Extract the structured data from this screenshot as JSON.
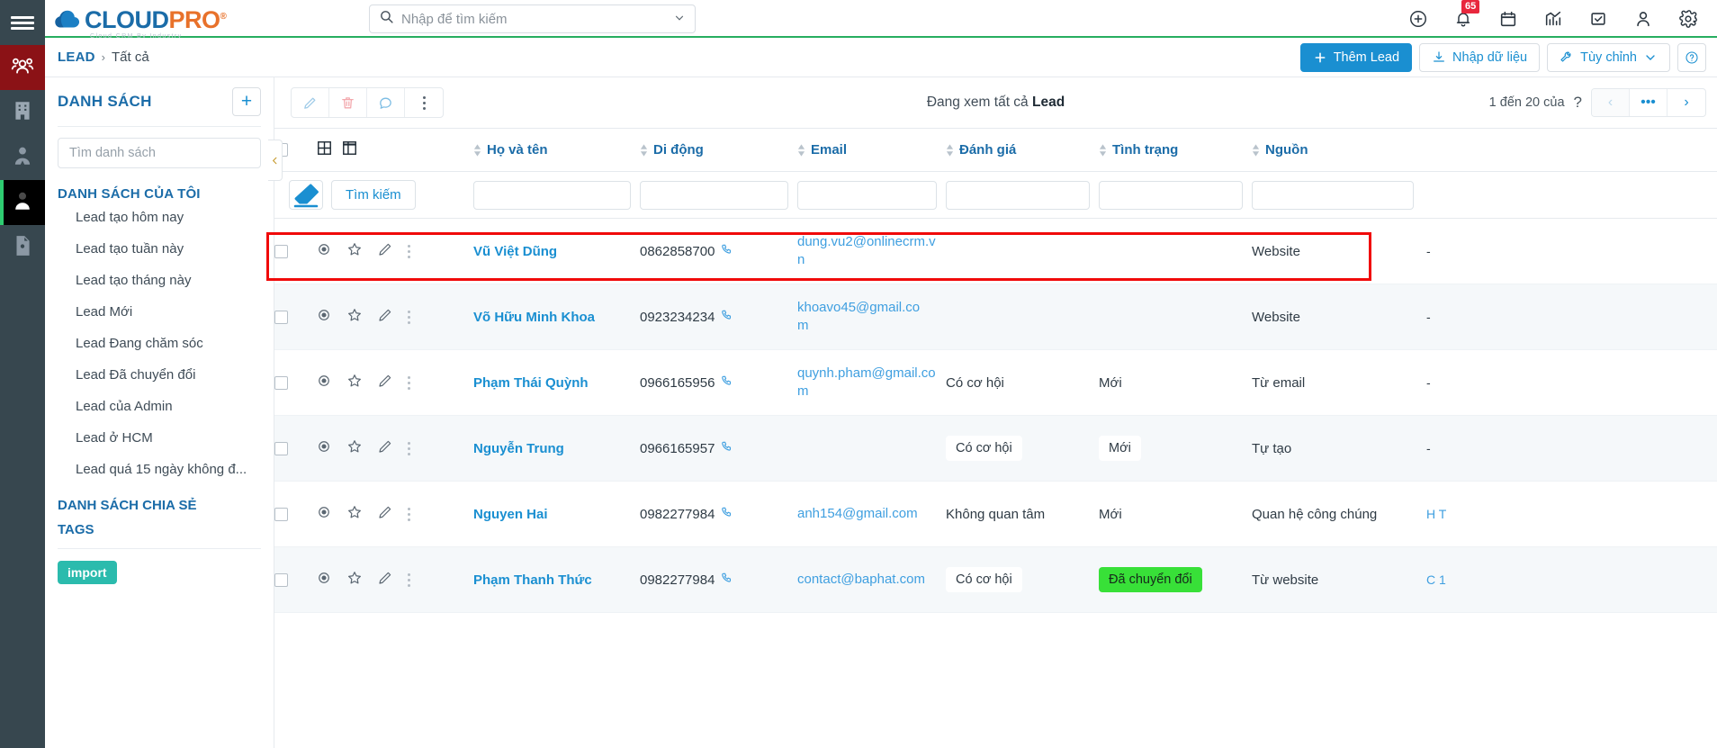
{
  "rail": {
    "menu_label": "menu-toggle",
    "items": [
      {
        "name": "customers-group",
        "icon": "people-group-icon",
        "active": "red"
      },
      {
        "name": "company",
        "icon": "building-icon",
        "active": "none"
      },
      {
        "name": "contact-person",
        "icon": "person-tie-icon",
        "active": "none"
      },
      {
        "name": "lead",
        "icon": "person-icon",
        "active": "dark"
      },
      {
        "name": "document-person",
        "icon": "document-person-icon",
        "active": "none"
      }
    ]
  },
  "brand": {
    "name_part1": "CLOUD",
    "name_part2": "PRO",
    "registered": "®",
    "tagline": "Cloud CRM By Industry"
  },
  "search": {
    "placeholder": "Nhập để tìm kiếm",
    "value": ""
  },
  "header_icons": [
    {
      "name": "add-circle-icon"
    },
    {
      "name": "notification-bell-icon",
      "badge": "65"
    },
    {
      "name": "calendar-icon"
    },
    {
      "name": "analytics-chart-icon"
    },
    {
      "name": "task-checkbox-icon"
    },
    {
      "name": "user-account-icon"
    },
    {
      "name": "settings-gear-icon"
    }
  ],
  "breadcrumb": {
    "root": "LEAD",
    "separator": "›",
    "current": "Tất cả"
  },
  "page_actions": {
    "add_lead": "Thêm Lead",
    "import_data": "Nhập dữ liệu",
    "customize": "Tùy chỉnh",
    "help": "?"
  },
  "sidebar": {
    "title": "DANH SÁCH",
    "add_button": "+",
    "search_placeholder": "Tìm danh sách",
    "group_my_lists": "DANH SÁCH CỦA TÔI",
    "items": [
      {
        "label": "Lead tạo hôm nay"
      },
      {
        "label": "Lead tạo tuần này"
      },
      {
        "label": "Lead tạo tháng này"
      },
      {
        "label": "Lead Mới"
      },
      {
        "label": "Lead Đang chăm sóc"
      },
      {
        "label": "Lead Đã chuyển đổi"
      },
      {
        "label": "Lead của Admin"
      },
      {
        "label": "Lead ở HCM"
      },
      {
        "label": "Lead quá 15 ngày không đ..."
      }
    ],
    "group_shared_lists": "DANH SÁCH CHIA SẺ",
    "tags_label": "TAGS",
    "tag_pill": "import"
  },
  "toolbar": {
    "edit": "edit-pencil-icon",
    "delete": "delete-trash-icon",
    "comment": "comment-bubble-icon",
    "more": "more-vertical-icon",
    "viewing_prefix": "Đang xem tất cả ",
    "viewing_entity": "Lead"
  },
  "pagination": {
    "range_text": "1 đến 20 của",
    "total_unknown": "?",
    "prev": "‹",
    "more": "•••",
    "next": "›"
  },
  "table": {
    "columns": [
      {
        "key": "name",
        "label": "Họ và tên"
      },
      {
        "key": "phone",
        "label": "Di động"
      },
      {
        "key": "email",
        "label": "Email"
      },
      {
        "key": "rating",
        "label": "Đánh giá"
      },
      {
        "key": "status",
        "label": "Tình trạng"
      },
      {
        "key": "source",
        "label": "Nguồn"
      }
    ],
    "filter": {
      "clear_label": "eraser-icon",
      "search_label": "Tìm kiếm",
      "values": [
        "",
        "",
        "",
        "",
        "",
        ""
      ]
    },
    "rows": [
      {
        "name": "Vũ Việt Dũng",
        "phone": "0862858700",
        "email": "dung.vu2@onlinecrm.vn",
        "rating": "",
        "rating_pill": false,
        "status": "",
        "status_pill": false,
        "status_green": false,
        "source": "Website",
        "last": "-",
        "highlighted": true
      },
      {
        "name": "Võ Hữu Minh Khoa",
        "phone": "0923234234",
        "email": "khoavo45@gmail.com",
        "rating": "",
        "rating_pill": false,
        "status": "",
        "status_pill": false,
        "status_green": false,
        "source": "Website",
        "last": "-",
        "highlighted": false
      },
      {
        "name": "Phạm Thái Quỳnh",
        "phone": "0966165956",
        "email": "quynh.pham@gmail.com",
        "rating": "Có cơ hội",
        "rating_pill": false,
        "status": "Mới",
        "status_pill": false,
        "status_green": false,
        "source": "Từ email",
        "last": "-",
        "highlighted": false
      },
      {
        "name": "Nguyễn Trung",
        "phone": "0966165957",
        "email": "",
        "rating": "Có cơ hội",
        "rating_pill": true,
        "status": "Mới",
        "status_pill": true,
        "status_green": false,
        "source": "Tự tạo",
        "last": "-",
        "highlighted": false
      },
      {
        "name": "Nguyen Hai",
        "phone": "0982277984",
        "email": "anh154@gmail.com",
        "rating": "Không quan tâm",
        "rating_pill": false,
        "status": "Mới",
        "status_pill": false,
        "status_green": false,
        "source": "Quan hệ công chúng",
        "last": "H T",
        "highlighted": false
      },
      {
        "name": "Phạm Thanh Thức",
        "phone": "0982277984",
        "email": "contact@baphat.com",
        "rating": "Có cơ hội",
        "rating_pill": true,
        "status": "Đã chuyển đổi",
        "status_pill": true,
        "status_green": true,
        "source": "Từ website",
        "last": "C 1",
        "highlighted": false
      }
    ]
  },
  "colors": {
    "accent_blue": "#1a8fd1",
    "brand_blue": "#1b6ca8",
    "brand_orange": "#e8712a",
    "green_badge": "#38e038",
    "red_badge": "#e8273d",
    "highlight_red": "#f00a0a",
    "teal_tag": "#2bbbad"
  }
}
